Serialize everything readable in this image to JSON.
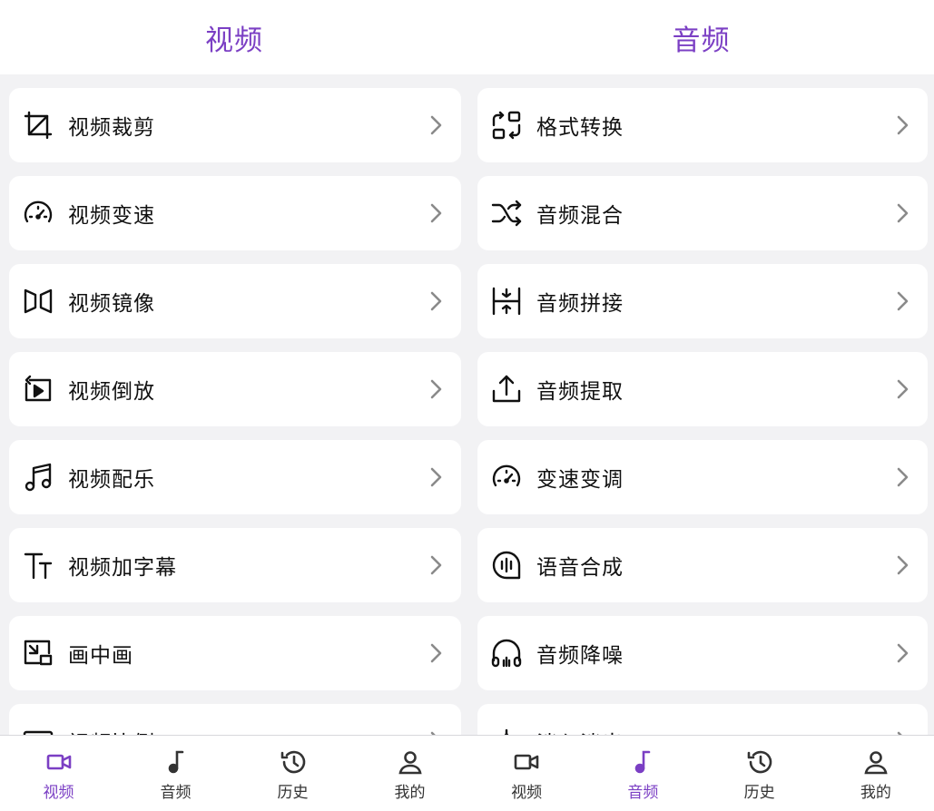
{
  "colors": {
    "accent": "#7b3fc4",
    "text": "#111111",
    "chevron": "#8a8a8a"
  },
  "left": {
    "title": "视频",
    "items": [
      {
        "label": "视频裁剪",
        "icon": "crop-icon"
      },
      {
        "label": "视频变速",
        "icon": "speedometer-icon"
      },
      {
        "label": "视频镜像",
        "icon": "mirror-icon"
      },
      {
        "label": "视频倒放",
        "icon": "reverse-play-icon"
      },
      {
        "label": "视频配乐",
        "icon": "music-note-icon"
      },
      {
        "label": "视频加字幕",
        "icon": "text-size-icon"
      },
      {
        "label": "画中画",
        "icon": "picture-in-picture-icon"
      },
      {
        "label": "视频比例",
        "icon": "aspect-ratio-icon"
      }
    ],
    "tabs": [
      {
        "label": "视频",
        "icon": "video-camera-icon",
        "active": true
      },
      {
        "label": "音频",
        "icon": "music-icon",
        "active": false
      },
      {
        "label": "历史",
        "icon": "history-icon",
        "active": false
      },
      {
        "label": "我的",
        "icon": "user-icon",
        "active": false
      }
    ]
  },
  "right": {
    "title": "音频",
    "items": [
      {
        "label": "格式转换",
        "icon": "format-convert-icon"
      },
      {
        "label": "音频混合",
        "icon": "shuffle-icon"
      },
      {
        "label": "音频拼接",
        "icon": "merge-icon"
      },
      {
        "label": "音频提取",
        "icon": "upload-icon"
      },
      {
        "label": "变速变调",
        "icon": "speedometer-icon"
      },
      {
        "label": "语音合成",
        "icon": "voice-synthesis-icon"
      },
      {
        "label": "音频降噪",
        "icon": "headphones-icon"
      },
      {
        "label": "淡入淡出",
        "icon": "fade-icon"
      }
    ],
    "tabs": [
      {
        "label": "视频",
        "icon": "video-camera-icon",
        "active": false
      },
      {
        "label": "音频",
        "icon": "music-icon",
        "active": true
      },
      {
        "label": "历史",
        "icon": "history-icon",
        "active": false
      },
      {
        "label": "我的",
        "icon": "user-icon",
        "active": false
      }
    ]
  }
}
